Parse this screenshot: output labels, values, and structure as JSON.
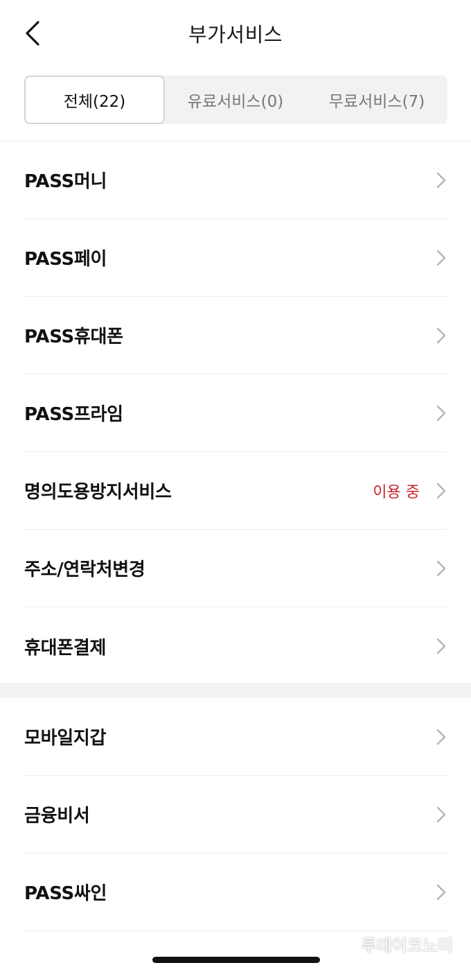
{
  "header": {
    "title": "부가서비스"
  },
  "tabs": [
    {
      "label": "전체(22)",
      "active": true
    },
    {
      "label": "유료서비스(0)",
      "active": false
    },
    {
      "label": "무료서비스(7)",
      "active": false
    }
  ],
  "group1": [
    {
      "label": "PASS머니"
    },
    {
      "label": "PASS페이"
    },
    {
      "label": "PASS휴대폰"
    },
    {
      "label": "PASS프라임"
    },
    {
      "label": "명의도용방지서비스",
      "status": "이용 중"
    },
    {
      "label": "주소/연락처변경"
    },
    {
      "label": "휴대폰결제"
    }
  ],
  "group2": [
    {
      "label": "모바일지갑"
    },
    {
      "label": "금융비서"
    },
    {
      "label": "PASS싸인"
    }
  ],
  "watermark": "투데이코노미",
  "colors": {
    "status": "#c8242b",
    "tab_bg": "#f2f2f2",
    "divider": "#ececec"
  }
}
